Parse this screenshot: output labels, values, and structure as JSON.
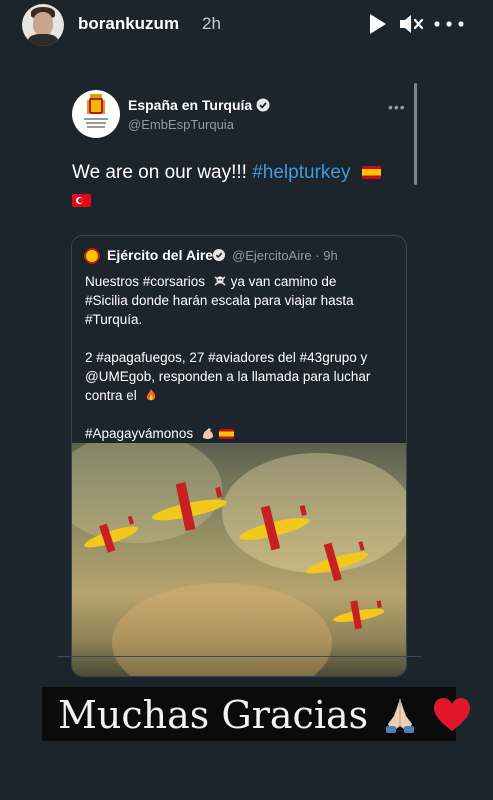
{
  "story": {
    "username": "borankuzum",
    "time": "2h"
  },
  "tweet": {
    "author_name": "España en Turquía",
    "author_handle": "@EmbEspTurquia",
    "text_plain": "We are on our way!!! ",
    "hashtag": "#helpturkey"
  },
  "quote": {
    "author_name": "Ejército del Aire",
    "author_handle": "@EjercitoAire · 9h",
    "line1": "Nuestros #corsarios",
    "line1_end": " ya van camino de",
    "line2": "#Sicilia donde harán escala para viajar hasta",
    "line3": "#Turquía.",
    "line4": "2 #apagafuegos, 27 #aviadores del #43grupo y",
    "line5": "@UMEgob, responden a la llamada para luchar",
    "line6": "contra el",
    "line7": "#Apagayvámonos"
  },
  "banner": {
    "text": "Muchas Gracias"
  },
  "colors": {
    "background": "#1c242c",
    "link": "#3f9bdc",
    "muted": "#8e9aa5"
  }
}
